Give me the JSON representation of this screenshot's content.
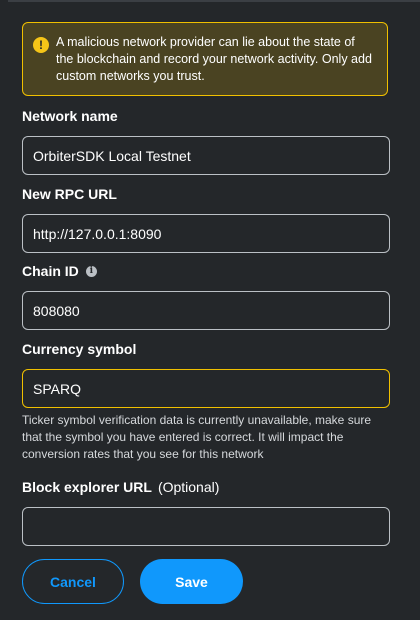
{
  "banner": {
    "icon": "warning-icon",
    "text": "A malicious network provider can lie about the state of the blockchain and record your network activity. Only add custom networks you trust."
  },
  "fields": {
    "network_name": {
      "label": "Network name",
      "value": "OrbiterSDK Local Testnet"
    },
    "rpc_url": {
      "label": "New RPC URL",
      "value": "http://127.0.0.1:8090"
    },
    "chain_id": {
      "label": "Chain ID",
      "value": "808080",
      "icon": "info-icon"
    },
    "currency_symbol": {
      "label": "Currency symbol",
      "value": "SPARQ",
      "help": "Ticker symbol verification data is currently unavailable, make sure that the symbol you have entered is correct. It will impact the conversion rates that you see for this network"
    },
    "block_explorer": {
      "label": "Block explorer URL",
      "optional": "(Optional)",
      "value": ""
    }
  },
  "buttons": {
    "cancel": "Cancel",
    "save": "Save"
  },
  "colors": {
    "background": "#24272a",
    "warning": "#f0c000",
    "primary": "#1098fc"
  }
}
